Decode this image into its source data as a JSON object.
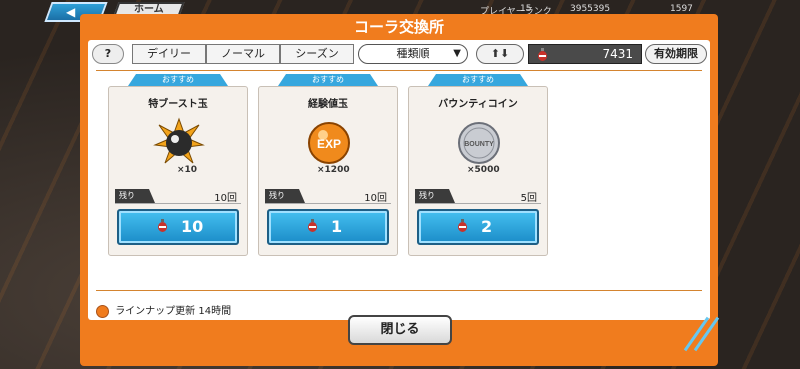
{
  "header": {
    "back_label": "◀",
    "home_label": "ホーム",
    "player_rank_label": "プレイヤーランク",
    "player_rank_value": "15",
    "money_value": "3955395",
    "gems_value": "1597"
  },
  "panel": {
    "title": "コーラ交換所"
  },
  "toolbar": {
    "help_label": "?",
    "tabs": [
      {
        "label": "デイリー",
        "active": true
      },
      {
        "label": "ノーマル",
        "active": false
      },
      {
        "label": "シーズン",
        "active": false
      }
    ],
    "sort_label": "種類順",
    "sort_arrow": "▼",
    "updown_label": "⬆⬇",
    "cola_count": "7431",
    "expiry_label": "有効期限"
  },
  "cards": [
    {
      "badge": "おすすめ",
      "title": "特ブースト玉",
      "qty": "×10",
      "remain_label": "残り",
      "remain_value": "10回",
      "cost": "10",
      "icon": "boost-orb-icon"
    },
    {
      "badge": "おすすめ",
      "title": "経験値玉",
      "qty": "×1200",
      "remain_label": "残り",
      "remain_value": "10回",
      "cost": "1",
      "icon": "exp-orb-icon"
    },
    {
      "badge": "おすすめ",
      "title": "バウンティコイン",
      "qty": "×5000",
      "remain_label": "残り",
      "remain_value": "5回",
      "cost": "2",
      "icon": "bounty-coin-icon"
    }
  ],
  "footer": {
    "lineup_label": "ラインナップ更新",
    "lineup_time": "14時間",
    "close_label": "閉じる"
  },
  "colors": {
    "panel": "#f07c1e",
    "accent_blue": "#36a7de"
  }
}
